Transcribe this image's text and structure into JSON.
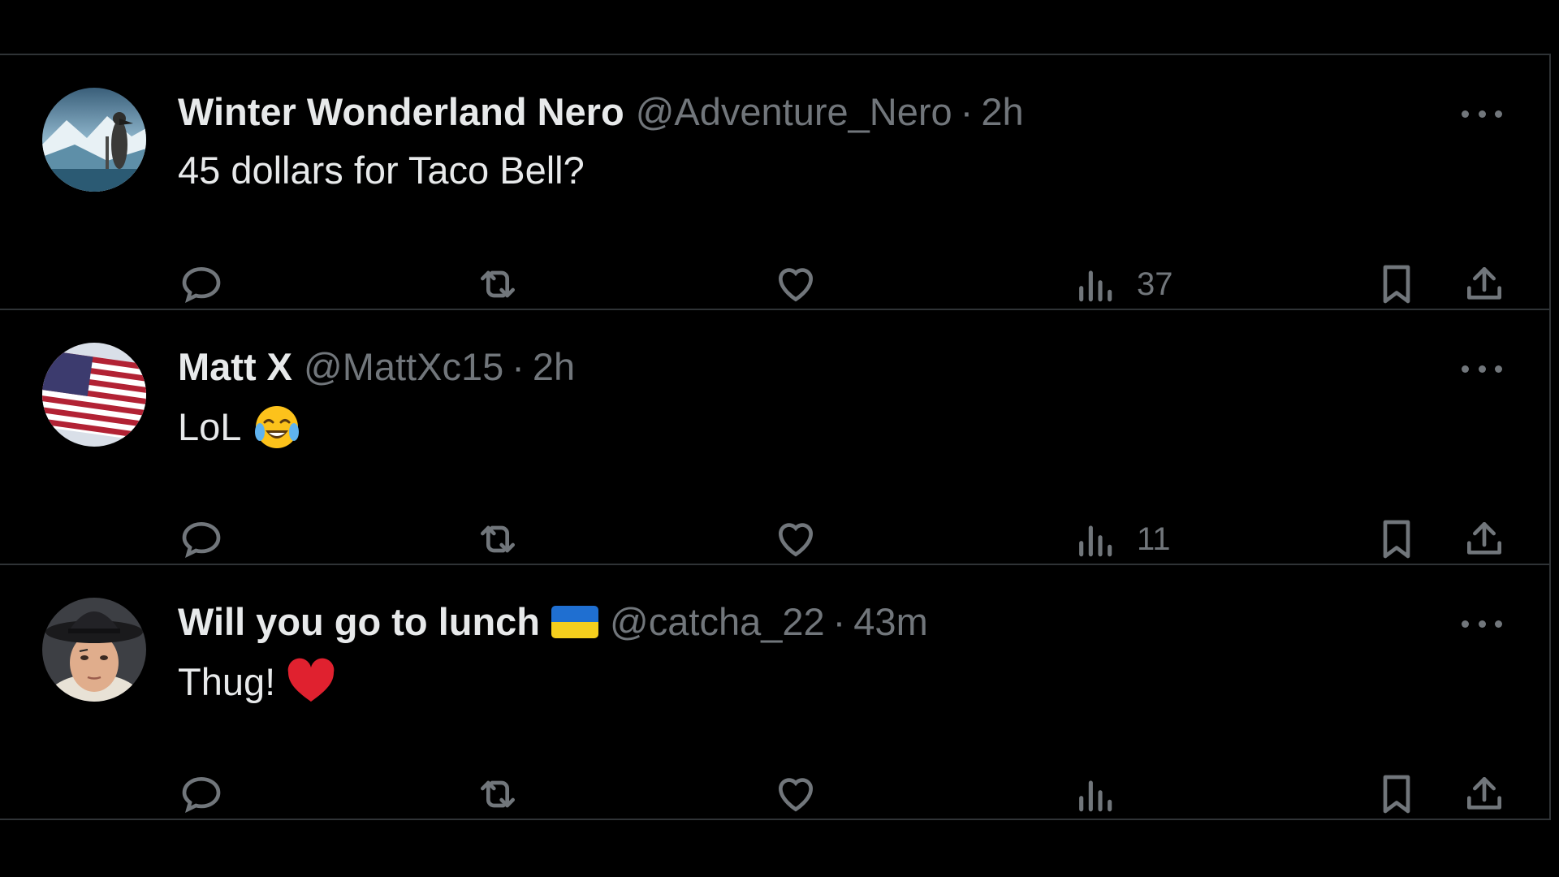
{
  "tweets": [
    {
      "display_name": "Winter Wonderland Nero",
      "handle": "@Adventure_Nero",
      "separator": "·",
      "time": "2h",
      "text": "45 dollars for Taco Bell?",
      "emoji": "",
      "name_badge": "",
      "avatar": "winter-landscape-avatar",
      "views": "37"
    },
    {
      "display_name": "Matt X",
      "handle": "@MattXc15",
      "separator": "·",
      "time": "2h",
      "text": "LoL",
      "emoji": "tears-of-joy-emoji",
      "name_badge": "",
      "avatar": "us-flag-avatar",
      "views": "11"
    },
    {
      "display_name": "Will you go to lunch",
      "handle": "@catcha_22",
      "separator": "·",
      "time": "43m",
      "text": "Thug!",
      "emoji": "red-heart-emoji",
      "name_badge": "ukraine-flag-emoji",
      "avatar": "bowler-hat-portrait-avatar",
      "views": ""
    }
  ],
  "icons": {
    "reply": "reply-icon",
    "retweet": "retweet-icon",
    "like": "like-icon",
    "views": "views-icon",
    "bookmark": "bookmark-icon",
    "share": "share-icon",
    "more": "more-icon"
  },
  "colors": {
    "background": "#000000",
    "text_primary": "#e7e9ea",
    "text_secondary": "#71767b",
    "divider": "#2f3336",
    "ukraine_blue": "#1f6fd1",
    "ukraine_yellow": "#f5cf1d",
    "heart_red": "#e0212f"
  }
}
